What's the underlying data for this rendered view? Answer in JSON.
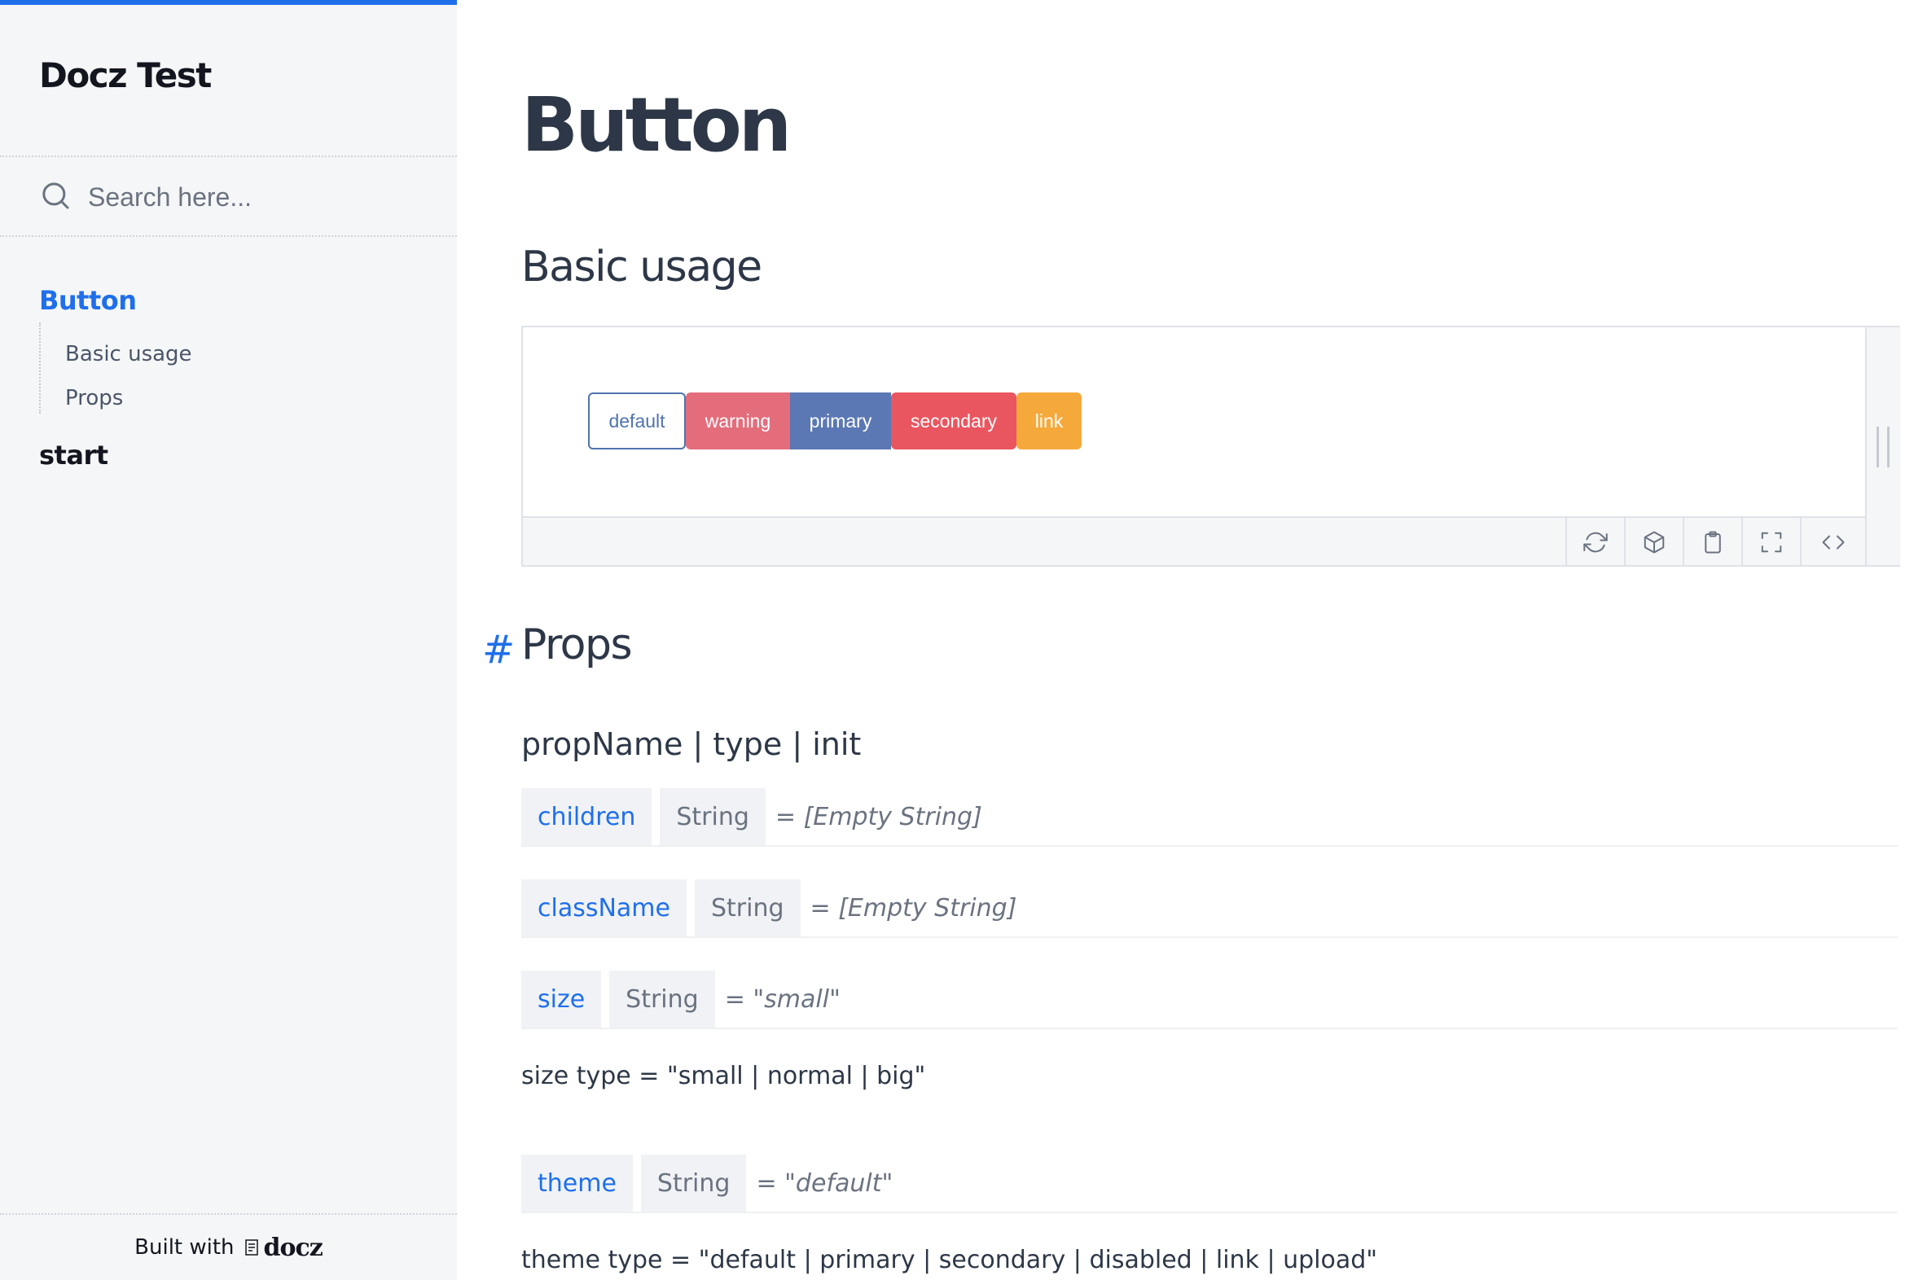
{
  "sidebar": {
    "logo": "Docz Test",
    "search_placeholder": "Search here...",
    "nav": [
      {
        "label": "Button",
        "active": true,
        "children": [
          "Basic usage",
          "Props"
        ]
      },
      {
        "label": "start",
        "active": false
      }
    ],
    "footer": {
      "text": "Built with",
      "brand": "docz"
    }
  },
  "main": {
    "title": "Button",
    "basic_usage_heading": "Basic usage",
    "playground": {
      "buttons": [
        {
          "label": "default",
          "variant": "default",
          "color": "#4f73ad"
        },
        {
          "label": "warning",
          "variant": "warning",
          "color": "#e46d7c"
        },
        {
          "label": "primary",
          "variant": "primary",
          "color": "#5b78b4"
        },
        {
          "label": "secondary",
          "variant": "secondary",
          "color": "#ea5660"
        },
        {
          "label": "link",
          "variant": "link",
          "color": "#f5a93b"
        }
      ],
      "toolbar_icons": [
        "refresh-icon",
        "package-icon",
        "clipboard-icon",
        "fullscreen-icon",
        "code-icon"
      ]
    },
    "props_anchor": "#",
    "props_heading": "Props",
    "props_table_header": "propName | type | init",
    "props": [
      {
        "name": "children",
        "type": "String",
        "default": "= [Empty String]"
      },
      {
        "name": "className",
        "type": "String",
        "default": "= [Empty String]"
      },
      {
        "name": "size",
        "type": "String",
        "default": "= \"small\""
      },
      {
        "name": "theme",
        "type": "String",
        "default": "= \"default\""
      }
    ],
    "notes": {
      "size": "size type = \"small | normal | big\"",
      "theme": "theme type = \"default | primary | secondary | disabled | link | upload\""
    }
  },
  "colors": {
    "accent": "#1f6feb",
    "sidebar_bg": "#f5f6f7",
    "text": "#2d3747"
  }
}
